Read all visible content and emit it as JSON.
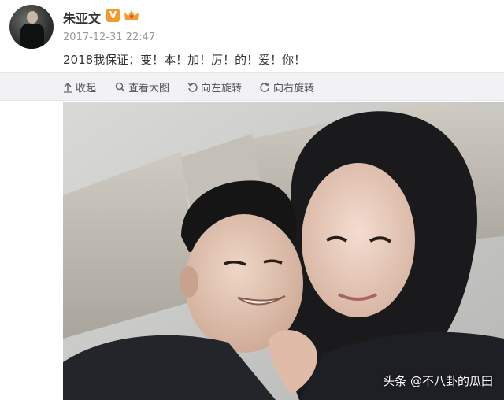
{
  "post": {
    "username": "朱亚文",
    "verified_badge": "V",
    "timestamp": "2017-12-31 22:47",
    "text": "2018我保证：变！本！加！厉！的！爱！你！"
  },
  "toolbar": {
    "collapse_label": "收起",
    "zoom_label": "查看大图",
    "rotate_left_label": "向左旋转",
    "rotate_right_label": "向右旋转"
  },
  "image": {
    "watermark": "头条 @不八卦的瓜田"
  },
  "colors": {
    "username": "#333333",
    "timestamp": "#999999",
    "badge_orange": "#f29b2a",
    "toolbar_bg": "#f2f2f5"
  },
  "icons": [
    "avatar",
    "verified-v-icon",
    "member-crown-icon",
    "collapse-arrow-icon",
    "magnifier-icon",
    "rotate-left-icon",
    "rotate-right-icon"
  ]
}
